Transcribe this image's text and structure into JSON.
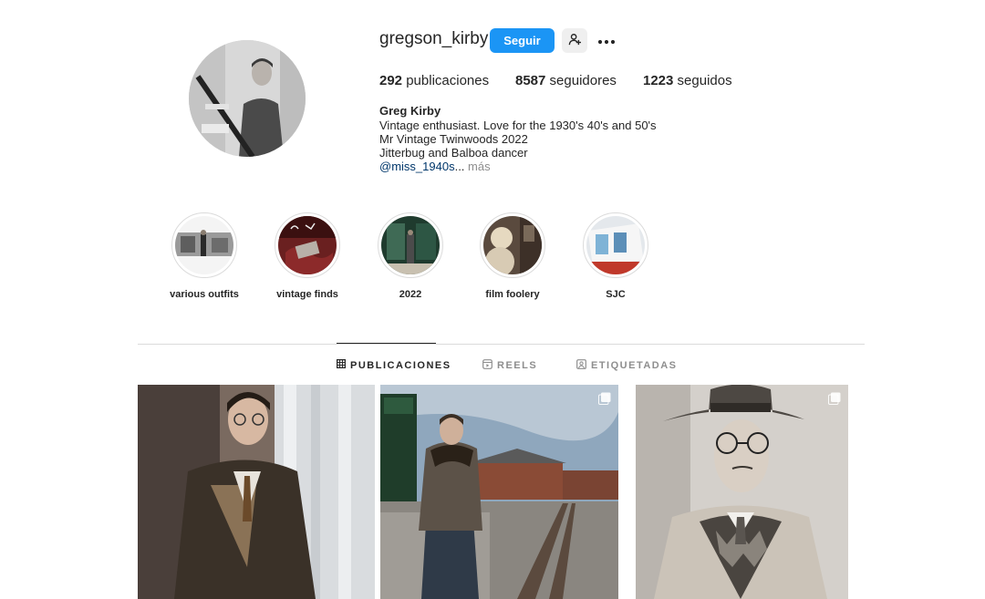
{
  "profile": {
    "username": "gregson_kirby",
    "follow_label": "Seguir",
    "stats": {
      "posts_count": "292",
      "posts_label": "publicaciones",
      "followers_count": "8587",
      "followers_label": "seguidores",
      "following_count": "1223",
      "following_label": "seguidos"
    },
    "bio": {
      "name": "Greg Kirby",
      "lines": [
        "Vintage enthusiast. Love for the 1930's 40's and 50's",
        "Mr Vintage Twinwoods 2022",
        "Jitterbug and Balboa dancer"
      ],
      "link": "@miss_1940s",
      "ellipsis": "...",
      "more": "más"
    }
  },
  "highlights": [
    {
      "label": "various outfits"
    },
    {
      "label": "vintage finds"
    },
    {
      "label": "2022"
    },
    {
      "label": "film foolery"
    },
    {
      "label": "SJC"
    }
  ],
  "tabs": [
    {
      "label": "PUBLICACIONES",
      "icon": "grid-icon",
      "active": true
    },
    {
      "label": "REELS",
      "icon": "reels-icon",
      "active": false
    },
    {
      "label": "ETIQUETADAS",
      "icon": "tagged-icon",
      "active": false
    }
  ],
  "colors": {
    "accent": "#1b95f5",
    "text": "#262626",
    "muted": "#8e8e8e",
    "link": "#00376b",
    "border": "#dbdbdb"
  }
}
